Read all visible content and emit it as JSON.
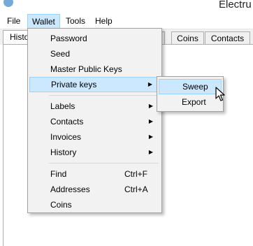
{
  "window": {
    "title": "Electru"
  },
  "menubar": {
    "items": [
      "File",
      "Wallet",
      "Tools",
      "Help"
    ]
  },
  "tabs": [
    "Histo",
    "Coins",
    "Contacts"
  ],
  "wallet_menu": {
    "password": "Password",
    "seed": "Seed",
    "master_public_keys": "Master Public Keys",
    "private_keys": "Private keys",
    "labels": "Labels",
    "contacts": "Contacts",
    "invoices": "Invoices",
    "history": "History",
    "find": "Find",
    "find_shortcut": "Ctrl+F",
    "addresses": "Addresses",
    "addresses_shortcut": "Ctrl+A",
    "coins": "Coins"
  },
  "private_keys_submenu": {
    "sweep": "Sweep",
    "export": "Export"
  },
  "colors": {
    "highlight": "#cce8ff",
    "highlight_border": "#99d1ff",
    "menu_bg": "#f2f2f2"
  }
}
